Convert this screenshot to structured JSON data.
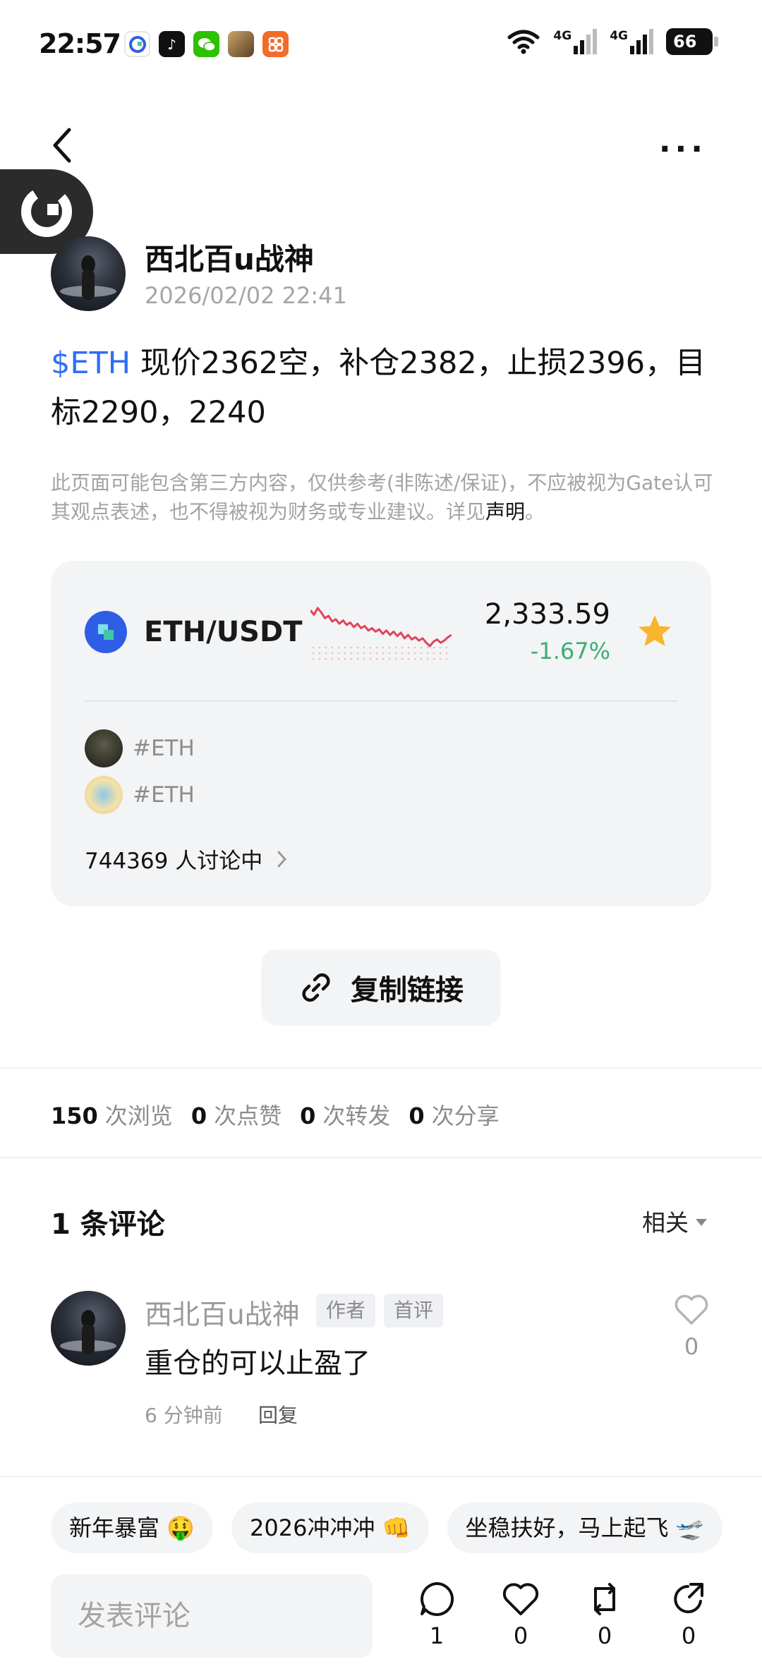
{
  "status_bar": {
    "time": "22:57",
    "apps": [
      {
        "icon": "gate-app-icon",
        "color": "#ffffff"
      },
      {
        "icon": "tiktok-icon",
        "color": "#111111"
      },
      {
        "icon": "wechat-icon",
        "color": "#2dc100"
      },
      {
        "icon": "game-app-icon",
        "color": "#8a6a3a"
      },
      {
        "icon": "app-grid-icon",
        "color": "#f26b2a"
      }
    ],
    "network_1": "4G",
    "network_2": "4G",
    "battery": "66"
  },
  "post": {
    "author": "西北百u战神",
    "time": "2026/02/02 22:41",
    "tag": "$ETH",
    "text": " 现价2362空，补仓2382，止损2396，目标2290，2240",
    "disclaimer": "此页面可能包含第三方内容，仅供参考(非陈述/保证)，不应被视为Gate认可其观点表述，也不得被视为财务或专业建议。详见",
    "disclaimer_link": "声明",
    "disclaimer_end": "。"
  },
  "market_card": {
    "pair": "ETH/USDT",
    "price": "2,333.59",
    "change": "-1.67%",
    "sparkline": [
      62,
      58,
      64,
      60,
      55,
      57,
      52,
      54,
      50,
      53,
      49,
      51,
      47,
      50,
      46,
      48,
      44,
      46,
      43,
      45,
      41,
      44,
      40,
      43,
      39,
      42,
      37,
      40,
      36,
      38,
      35,
      37,
      33,
      30,
      34,
      36,
      33,
      35,
      38,
      40
    ],
    "tags": [
      "#ETH",
      "#ETH"
    ],
    "discussion": "744369 人讨论中"
  },
  "copy_link_label": "复制链接",
  "stats": [
    {
      "num": "150",
      "label": "次浏览"
    },
    {
      "num": "0",
      "label": "次点赞"
    },
    {
      "num": "0",
      "label": "次转发"
    },
    {
      "num": "0",
      "label": "次分享"
    }
  ],
  "comments": {
    "title": "1 条评论",
    "sort": "相关",
    "items": [
      {
        "author": "西北百u战神",
        "badge_author": "作者",
        "badge_first": "首评",
        "text": "重仓的可以止盈了",
        "time": "6 分钟前",
        "reply": "回复",
        "likes": "0"
      }
    ]
  },
  "quick_chips": [
    "新年暴富 🤑",
    "2026冲冲冲 👊",
    "坐稳扶好，马上起飞 🛫"
  ],
  "bottom_bar": {
    "input_placeholder": "发表评论",
    "comment_count": "1",
    "like_count": "0",
    "repost_count": "0",
    "share_count": "0"
  },
  "colors": {
    "accent_blue": "#2f6df6",
    "price_down_green": "#3dae6f",
    "sparkline_red": "#e0435a",
    "star_yellow": "#f7b52c"
  }
}
